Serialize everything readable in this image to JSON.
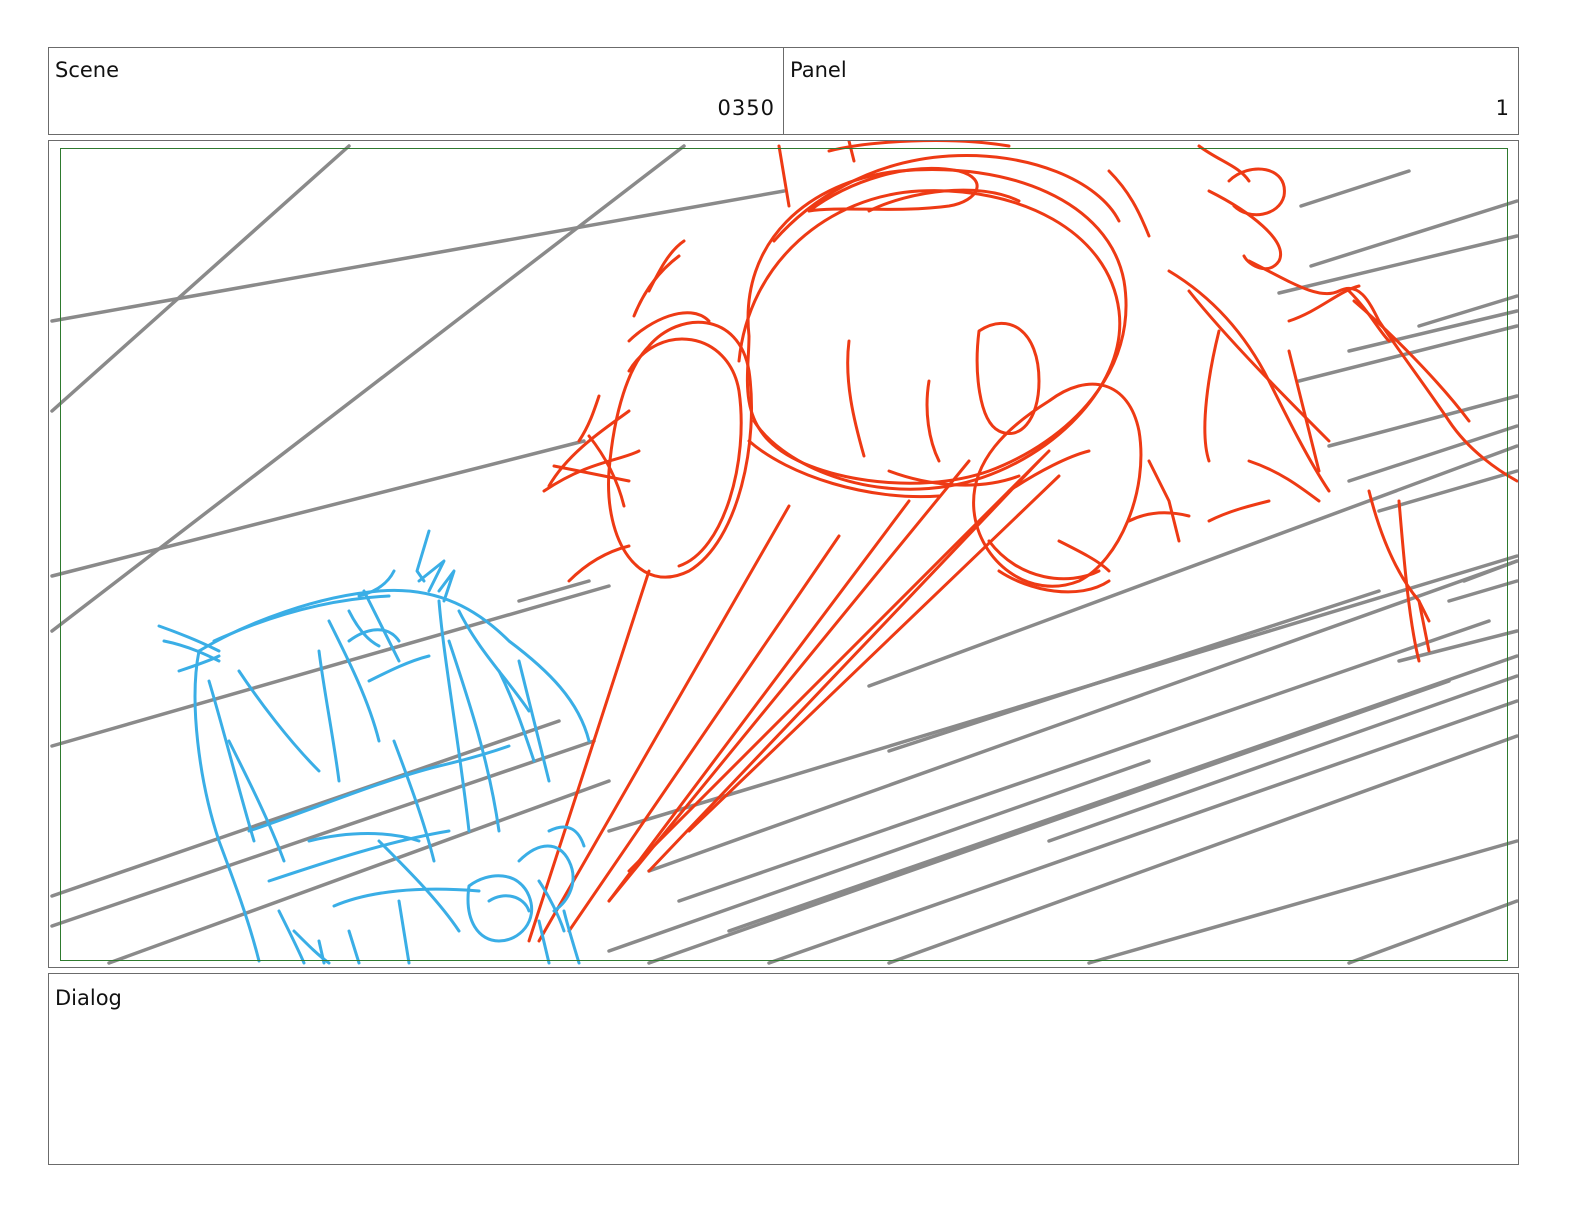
{
  "header": {
    "scene_label": "Scene",
    "scene_value": "0350",
    "panel_label": "Panel",
    "panel_value": "1"
  },
  "frame": {
    "safe_area_color": "#2e7a2e",
    "layers": [
      "background speed lines",
      "red character sketch",
      "blue character sketch"
    ],
    "colors": {
      "background_lines": "#8a8a8a",
      "red_sketch": "#ee3a14",
      "blue_sketch": "#3aaee6"
    }
  },
  "dialog": {
    "label": "Dialog",
    "text": ""
  }
}
